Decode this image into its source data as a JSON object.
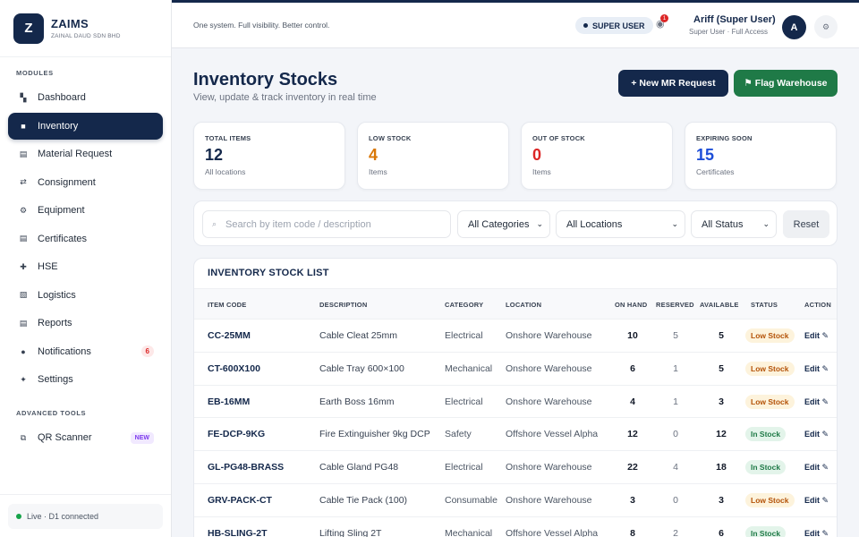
{
  "brand": {
    "logo_letter": "Z",
    "name": "ZAIMS",
    "company": "ZAINAL DAUD SDN BHD"
  },
  "sidebar": {
    "modules_label": "MODULES",
    "items": [
      {
        "label": "Dashboard",
        "icon": "dashboard-icon",
        "glyph": "▚"
      },
      {
        "label": "Inventory",
        "icon": "inventory-icon",
        "glyph": "■"
      },
      {
        "label": "Material Request",
        "icon": "material-request-icon",
        "glyph": "▤"
      },
      {
        "label": "Consignment",
        "icon": "consignment-icon",
        "glyph": "⇄"
      },
      {
        "label": "Equipment",
        "icon": "equipment-icon",
        "glyph": "⚙"
      },
      {
        "label": "Certificates",
        "icon": "certificates-icon",
        "glyph": "▤"
      },
      {
        "label": "HSE",
        "icon": "hse-icon",
        "glyph": "✚"
      },
      {
        "label": "Logistics",
        "icon": "logistics-icon",
        "glyph": "▧"
      },
      {
        "label": "Reports",
        "icon": "reports-icon",
        "glyph": "▤"
      },
      {
        "label": "Notifications",
        "icon": "notifications-icon",
        "glyph": "●",
        "badge": "6"
      },
      {
        "label": "Settings",
        "icon": "settings-icon",
        "glyph": "✦"
      }
    ],
    "advanced_label": "ADVANCED TOOLS",
    "advanced_items": [
      {
        "label": "QR Scanner",
        "icon": "qr-scanner-icon",
        "glyph": "⧉",
        "tag": "NEW"
      }
    ],
    "footer_status": "Live · D1 connected"
  },
  "topbar": {
    "tagline": "One system. Full visibility. Better control.",
    "role_badge": "SUPER USER",
    "notification_count": "1",
    "user_name": "Ariff (Super User)",
    "user_role": "Super User · Full Access",
    "avatar_letter": "A"
  },
  "page": {
    "title": "Inventory Stocks",
    "subtitle": "View, update & track inventory in real time",
    "new_mr_button": "+  New MR Request",
    "flag_button": "⚑ Flag Warehouse"
  },
  "stats": [
    {
      "label": "TOTAL ITEMS",
      "value": "12",
      "sub": "All locations",
      "color": "#14284b"
    },
    {
      "label": "LOW STOCK",
      "value": "4",
      "sub": "Items",
      "color": "#d97706"
    },
    {
      "label": "OUT OF STOCK",
      "value": "0",
      "sub": "Items",
      "color": "#dc2626"
    },
    {
      "label": "EXPIRING SOON",
      "value": "15",
      "sub": "Certificates",
      "color": "#1d4ed8"
    }
  ],
  "filters": {
    "search_placeholder": "Search by item code / description",
    "search_value": "",
    "category": "All Categories",
    "location": "All Locations",
    "status": "All Status",
    "reset": "Reset"
  },
  "table": {
    "title": "INVENTORY STOCK LIST",
    "headers": [
      "ITEM CODE",
      "DESCRIPTION",
      "CATEGORY",
      "LOCATION",
      "ON HAND",
      "RESERVED",
      "AVAILABLE",
      "STATUS",
      "ACTION"
    ],
    "edit_label": "Edit ✎",
    "rows": [
      {
        "code": "CC-25MM",
        "description": "Cable Cleat 25mm",
        "category": "Electrical",
        "location": "Onshore Warehouse",
        "on_hand": "10",
        "reserved": "5",
        "available": "5",
        "status": "Low Stock"
      },
      {
        "code": "CT-600X100",
        "description": "Cable Tray 600×100",
        "category": "Mechanical",
        "location": "Onshore Warehouse",
        "on_hand": "6",
        "reserved": "1",
        "available": "5",
        "status": "Low Stock"
      },
      {
        "code": "EB-16MM",
        "description": "Earth Boss 16mm",
        "category": "Electrical",
        "location": "Onshore Warehouse",
        "on_hand": "4",
        "reserved": "1",
        "available": "3",
        "status": "Low Stock"
      },
      {
        "code": "FE-DCP-9KG",
        "description": "Fire Extinguisher 9kg DCP",
        "category": "Safety",
        "location": "Offshore Vessel Alpha",
        "on_hand": "12",
        "reserved": "0",
        "available": "12",
        "status": "In Stock"
      },
      {
        "code": "GL-PG48-BRASS",
        "description": "Cable Gland PG48",
        "category": "Electrical",
        "location": "Onshore Warehouse",
        "on_hand": "22",
        "reserved": "4",
        "available": "18",
        "status": "In Stock"
      },
      {
        "code": "GRV-PACK-CT",
        "description": "Cable Tie Pack (100)",
        "category": "Consumable",
        "location": "Onshore Warehouse",
        "on_hand": "3",
        "reserved": "0",
        "available": "3",
        "status": "Low Stock"
      },
      {
        "code": "HB-SLING-2T",
        "description": "Lifting Sling 2T",
        "category": "Mechanical",
        "location": "Offshore Vessel Alpha",
        "on_hand": "8",
        "reserved": "2",
        "available": "6",
        "status": "In Stock"
      }
    ]
  }
}
